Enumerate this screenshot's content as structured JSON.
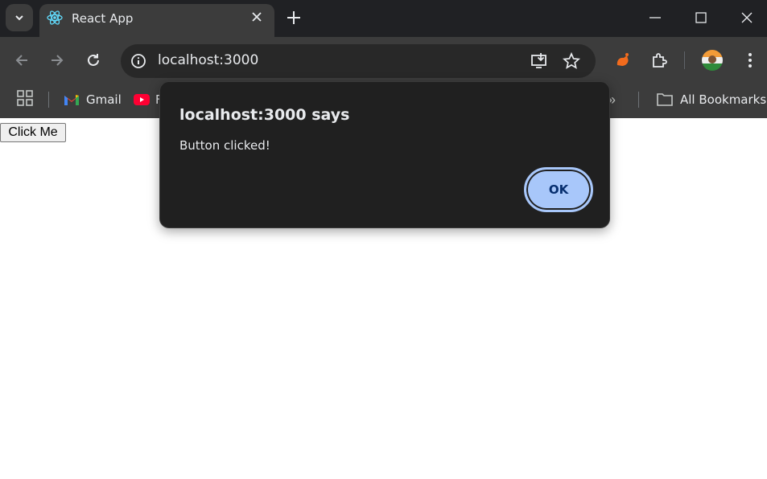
{
  "tab": {
    "title": "React App"
  },
  "omnibox": {
    "url": "localhost:3000"
  },
  "bookmarks": {
    "items": [
      {
        "label": "Gmail",
        "icon": "gmail-icon"
      },
      {
        "label": "F",
        "icon": "youtube-icon"
      }
    ],
    "all_bookmarks": "All Bookmarks",
    "more": "»"
  },
  "page": {
    "button_label": "Click Me"
  },
  "dialog": {
    "title": "localhost:3000 says",
    "message": "Button clicked!",
    "ok_label": "OK"
  },
  "colors": {
    "chrome_dark": "#202124",
    "toolbar": "#3c3c3c",
    "dialog_bg": "#202020",
    "ok_button": "#a8c7fa",
    "ok_text": "#062e6f"
  }
}
